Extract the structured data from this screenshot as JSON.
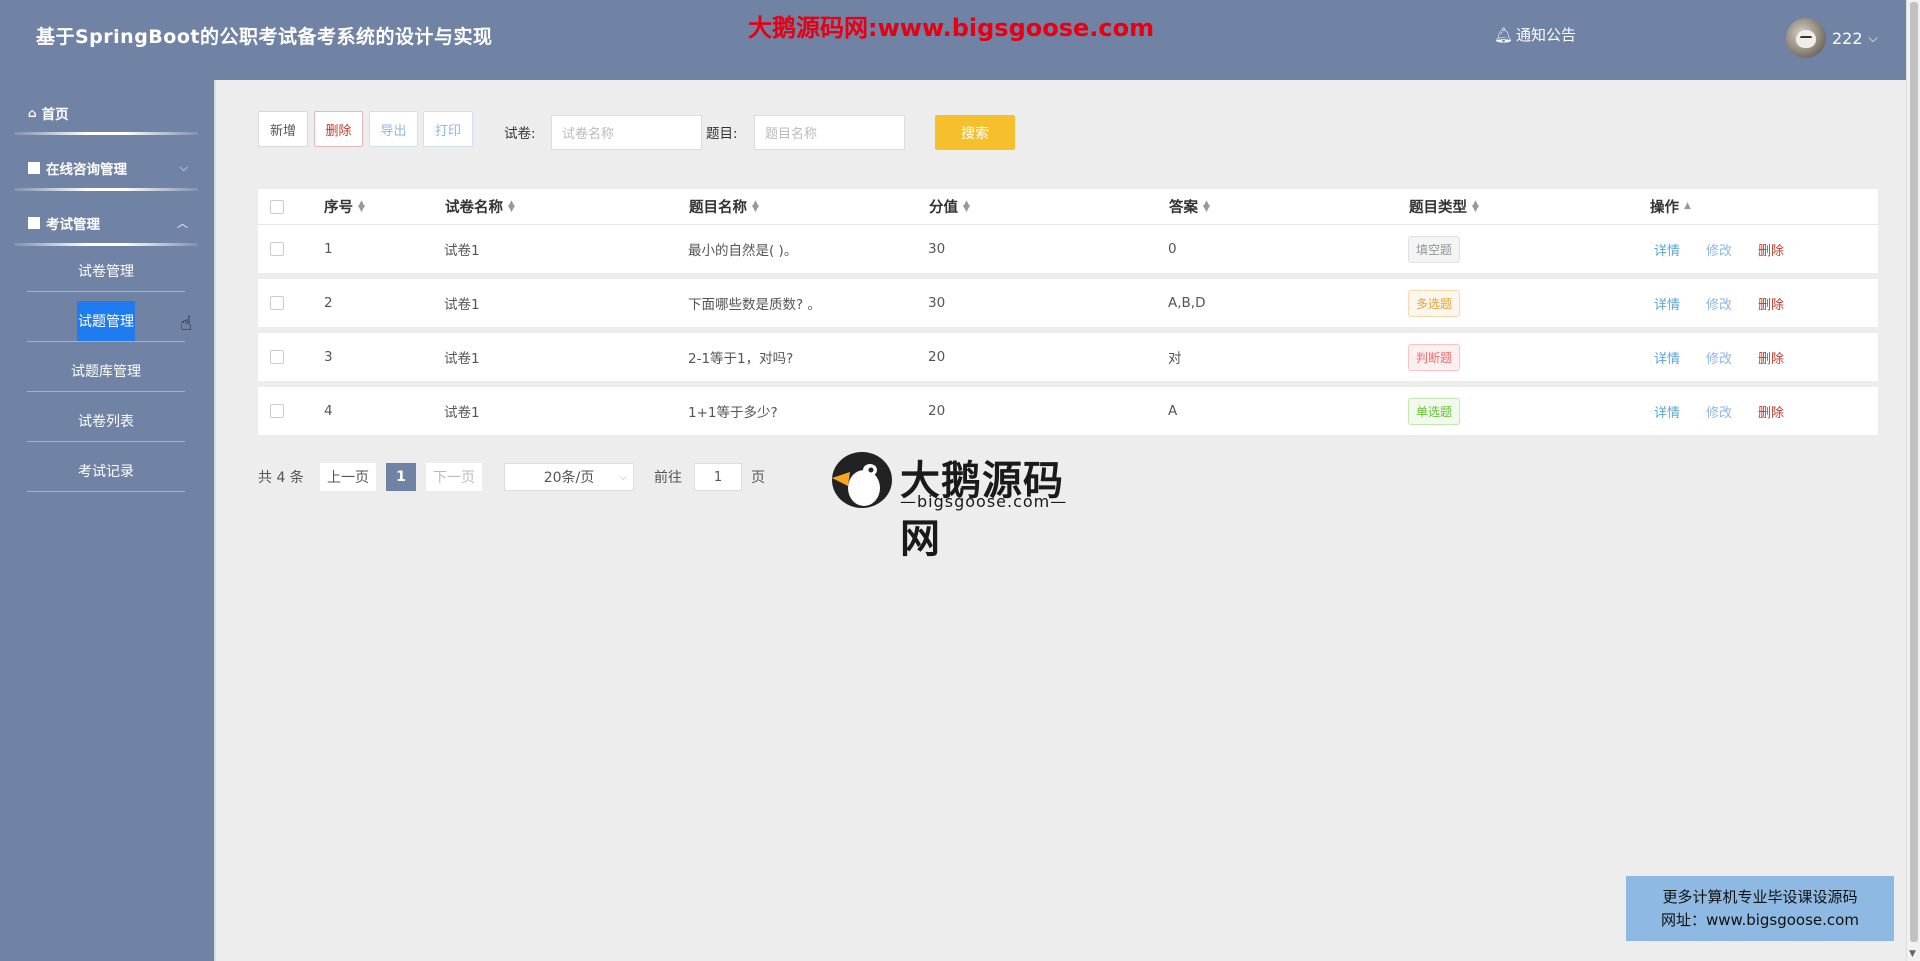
{
  "header": {
    "title": "基于SpringBoot的公职考试备考系统的设计与实现",
    "watermark": "大鹅源码网:www.bigsgoose.com",
    "notice": "通知公告",
    "username": "222"
  },
  "sidebar": {
    "home": "首页",
    "consult": "在线咨询管理",
    "exam_mgmt": "考试管理",
    "sub_items": [
      "试卷管理",
      "试题管理",
      "试题库管理",
      "试卷列表",
      "考试记录"
    ]
  },
  "toolbar": {
    "add": "新增",
    "delete": "删除",
    "export": "导出",
    "print": "打印",
    "paper_label": "试卷:",
    "paper_placeholder": "试卷名称",
    "question_label": "题目:",
    "question_placeholder": "题目名称",
    "search": "搜索"
  },
  "table": {
    "headers": [
      "序号",
      "试卷名称",
      "题目名称",
      "分值",
      "答案",
      "题目类型",
      "操作"
    ],
    "rows": [
      {
        "no": "1",
        "paper": "试卷1",
        "question": "最小的自然是( )。",
        "score": "30",
        "answer": "0",
        "type": "填空题"
      },
      {
        "no": "2",
        "paper": "试卷1",
        "question": "下面哪些数是质数? 。",
        "score": "30",
        "answer": "A,B,D",
        "type": "多选题"
      },
      {
        "no": "3",
        "paper": "试卷1",
        "question": "2-1等于1，对吗?",
        "score": "20",
        "answer": "对",
        "type": "判断题"
      },
      {
        "no": "4",
        "paper": "试卷1",
        "question": "1+1等于多少?",
        "score": "20",
        "answer": "A",
        "type": "单选题"
      }
    ],
    "actions": {
      "detail": "详情",
      "edit": "修改",
      "delete": "删除"
    }
  },
  "pagination": {
    "total": "共 4 条",
    "prev": "上一页",
    "current": "1",
    "next": "下一页",
    "page_size": "20条/页",
    "goto": "前往",
    "goto_value": "1",
    "page_unit": "页"
  },
  "logo": {
    "text": "大鹅源码网",
    "sub": "—bigsgoose.com—"
  },
  "ad": {
    "line1": "更多计算机专业毕设课设源码",
    "line2": "网址：www.bigsgoose.com"
  },
  "colors": {
    "header_bg": "#7183a5",
    "accent_blue": "#1e7cf0",
    "search_yellow": "#f5c02b",
    "delete_red": "#c0392b",
    "link_blue": "#409eff"
  }
}
